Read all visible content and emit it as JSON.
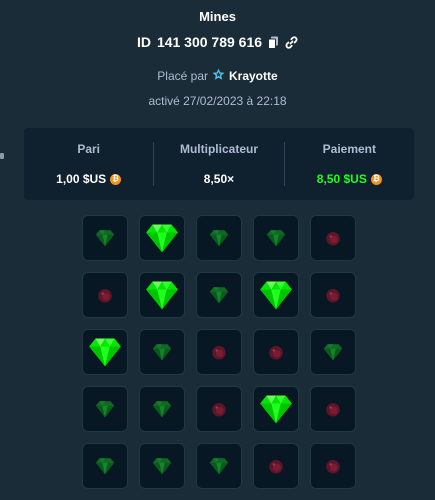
{
  "game": {
    "title": "Mines",
    "id_prefix": "ID",
    "id": "141 300 789 616",
    "copy_icon": "copy-icon",
    "link_icon": "link-icon"
  },
  "placed": {
    "prefix": "Placé par",
    "user": "Krayotte",
    "badge_icon": "star-icon",
    "badge_color": "#4dc4ee"
  },
  "activated": "activé 27/02/2023 à 22:18",
  "stats": {
    "bet": {
      "label": "Pari",
      "value": "1,00 $US",
      "currency_icon": "bitcoin-icon"
    },
    "multiplier": {
      "label": "Multiplicateur",
      "value": "8,50×"
    },
    "payout": {
      "label": "Paiement",
      "value": "8,50 $US",
      "currency_icon": "bitcoin-icon"
    }
  },
  "colors": {
    "background": "#1a2c38",
    "panel": "#0f212e",
    "tile": "#071824",
    "accent_green": "#1fff20",
    "coin": "#f7931a",
    "mine": "#c0193e"
  },
  "grid": {
    "rows": 5,
    "cols": 5,
    "tiles": [
      "gem-dim",
      "gem-revealed",
      "gem-dim",
      "gem-dim",
      "mine-dim",
      "mine-dim",
      "gem-revealed",
      "gem-dim",
      "gem-revealed",
      "mine-dim",
      "gem-revealed",
      "gem-dim",
      "mine-dim",
      "mine-dim",
      "gem-dim",
      "gem-dim",
      "gem-dim",
      "mine-dim",
      "gem-revealed",
      "mine-dim",
      "gem-dim",
      "gem-dim",
      "gem-dim",
      "mine-dim",
      "mine-dim"
    ]
  }
}
